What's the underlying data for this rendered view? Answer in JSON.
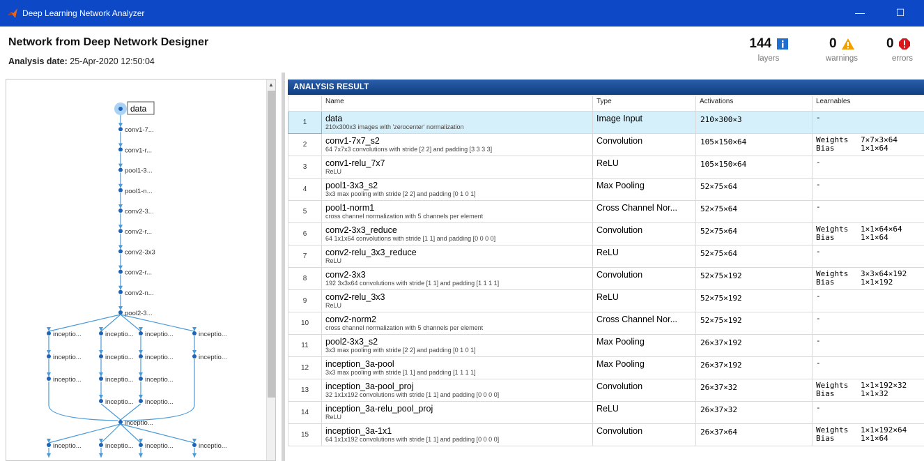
{
  "window": {
    "title": "Deep Learning Network Analyzer",
    "minimize": "—",
    "maximize": "☐"
  },
  "header": {
    "title": "Network from Deep Network Designer",
    "date_label": "Analysis date:",
    "date_value": "25-Apr-2020 12:50:04",
    "stats": {
      "layers": {
        "value": "144",
        "label": "layers",
        "icon": "info-icon"
      },
      "warnings": {
        "value": "0",
        "label": "warnings",
        "icon": "warning-icon"
      },
      "errors": {
        "value": "0",
        "label": "errors",
        "icon": "error-icon"
      }
    }
  },
  "graph": {
    "chain": [
      "data",
      "conv1-7...",
      "conv1-r...",
      "pool1-3...",
      "pool1-n...",
      "conv2-3...",
      "conv2-r...",
      "conv2-3x3",
      "conv2-r...",
      "conv2-n...",
      "pool2-3..."
    ],
    "branch_row1": [
      "inceptio...",
      "inceptio...",
      "inceptio...",
      "inceptio..."
    ],
    "branch_row2": [
      "inceptio...",
      "inceptio...",
      "inceptio...",
      "inceptio..."
    ],
    "branch_row3": [
      "inceptio...",
      "inceptio...",
      "inceptio..."
    ],
    "branch_row4": [
      "inceptio...",
      "inceptio..."
    ],
    "merge": "inceptio...",
    "branch_row5": [
      "inceptio...",
      "inceptio...",
      "inceptio...",
      "inceptio..."
    ]
  },
  "results": {
    "header": "ANALYSIS RESULT",
    "columns": [
      "",
      "Name",
      "Type",
      "Activations",
      "Learnables"
    ],
    "rows": [
      {
        "idx": "1",
        "name": "data",
        "desc": "210x300x3 images with 'zerocenter' normalization",
        "type": "Image Input",
        "act": "210×300×3",
        "learn": [],
        "selected": true
      },
      {
        "idx": "2",
        "name": "conv1-7x7_s2",
        "desc": "64 7x7x3 convolutions with stride [2 2] and padding [3 3 3 3]",
        "type": "Convolution",
        "act": "105×150×64",
        "learn": [
          [
            "Weights",
            "7×7×3×64"
          ],
          [
            "Bias",
            "1×1×64"
          ]
        ]
      },
      {
        "idx": "3",
        "name": "conv1-relu_7x7",
        "desc": "ReLU",
        "type": "ReLU",
        "act": "105×150×64",
        "learn": []
      },
      {
        "idx": "4",
        "name": "pool1-3x3_s2",
        "desc": "3x3 max pooling with stride [2 2] and padding [0 1 0 1]",
        "type": "Max Pooling",
        "act": "52×75×64",
        "learn": []
      },
      {
        "idx": "5",
        "name": "pool1-norm1",
        "desc": "cross channel normalization with 5 channels per element",
        "type": "Cross Channel Nor...",
        "act": "52×75×64",
        "learn": []
      },
      {
        "idx": "6",
        "name": "conv2-3x3_reduce",
        "desc": "64 1x1x64 convolutions with stride [1 1] and padding [0 0 0 0]",
        "type": "Convolution",
        "act": "52×75×64",
        "learn": [
          [
            "Weights",
            "1×1×64×64"
          ],
          [
            "Bias",
            "1×1×64"
          ]
        ]
      },
      {
        "idx": "7",
        "name": "conv2-relu_3x3_reduce",
        "desc": "ReLU",
        "type": "ReLU",
        "act": "52×75×64",
        "learn": []
      },
      {
        "idx": "8",
        "name": "conv2-3x3",
        "desc": "192 3x3x64 convolutions with stride [1 1] and padding [1 1 1 1]",
        "type": "Convolution",
        "act": "52×75×192",
        "learn": [
          [
            "Weights",
            "3×3×64×192"
          ],
          [
            "Bias",
            "1×1×192"
          ]
        ]
      },
      {
        "idx": "9",
        "name": "conv2-relu_3x3",
        "desc": "ReLU",
        "type": "ReLU",
        "act": "52×75×192",
        "learn": []
      },
      {
        "idx": "10",
        "name": "conv2-norm2",
        "desc": "cross channel normalization with 5 channels per element",
        "type": "Cross Channel Nor...",
        "act": "52×75×192",
        "learn": []
      },
      {
        "idx": "11",
        "name": "pool2-3x3_s2",
        "desc": "3x3 max pooling with stride [2 2] and padding [0 1 0 1]",
        "type": "Max Pooling",
        "act": "26×37×192",
        "learn": []
      },
      {
        "idx": "12",
        "name": "inception_3a-pool",
        "desc": "3x3 max pooling with stride [1 1] and padding [1 1 1 1]",
        "type": "Max Pooling",
        "act": "26×37×192",
        "learn": []
      },
      {
        "idx": "13",
        "name": "inception_3a-pool_proj",
        "desc": "32 1x1x192 convolutions with stride [1 1] and padding [0 0 0 0]",
        "type": "Convolution",
        "act": "26×37×32",
        "learn": [
          [
            "Weights",
            "1×1×192×32"
          ],
          [
            "Bias",
            "1×1×32"
          ]
        ]
      },
      {
        "idx": "14",
        "name": "inception_3a-relu_pool_proj",
        "desc": "ReLU",
        "type": "ReLU",
        "act": "26×37×32",
        "learn": []
      },
      {
        "idx": "15",
        "name": "inception_3a-1x1",
        "desc": "64 1x1x192 convolutions with stride [1 1] and padding [0 0 0 0]",
        "type": "Convolution",
        "act": "26×37×64",
        "learn": [
          [
            "Weights",
            "1×1×192×64"
          ],
          [
            "Bias",
            "1×1×64"
          ]
        ]
      }
    ],
    "empty_learnables": "-"
  }
}
